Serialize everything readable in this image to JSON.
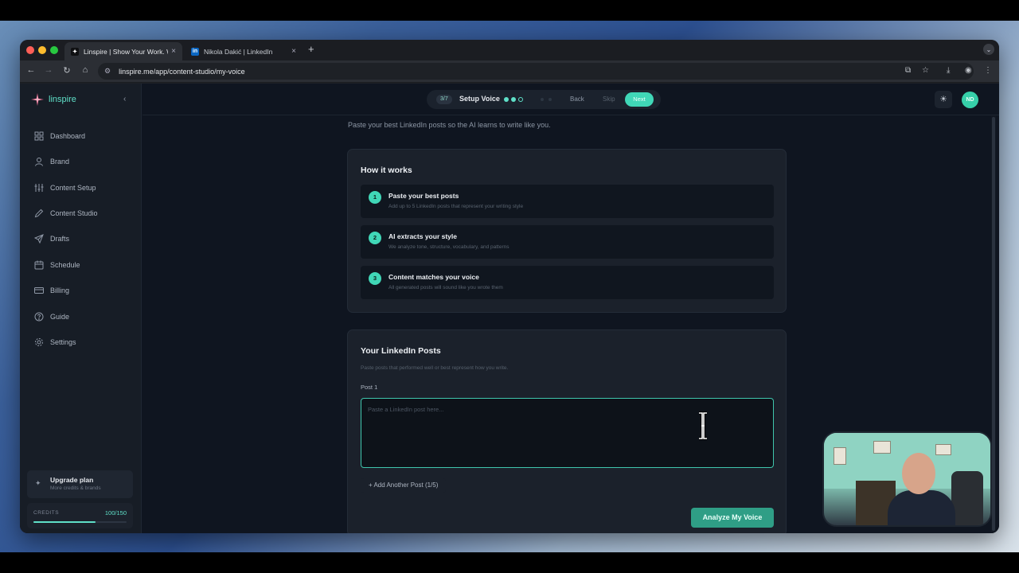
{
  "browser": {
    "tabs": [
      {
        "title": "Linspire | Show Your Work. W",
        "favicon": "linspire-icon",
        "active": true
      },
      {
        "title": "Nikola Dakić | LinkedIn",
        "favicon": "linkedin-icon",
        "active": false
      }
    ],
    "new_tab": "+",
    "url": "linspire.me/app/content-studio/my-voice"
  },
  "sidebar": {
    "brand": "linspire",
    "items": [
      {
        "label": "Dashboard",
        "icon": "grid-icon"
      },
      {
        "label": "Brand",
        "icon": "user-icon"
      },
      {
        "label": "Content Setup",
        "icon": "sliders-icon"
      },
      {
        "label": "Content Studio",
        "icon": "pencil-icon"
      },
      {
        "label": "Drafts",
        "icon": "send-icon"
      },
      {
        "label": "Schedule",
        "icon": "calendar-icon"
      },
      {
        "label": "Billing",
        "icon": "card-icon"
      },
      {
        "label": "Guide",
        "icon": "help-icon"
      },
      {
        "label": "Settings",
        "icon": "gear-icon"
      }
    ],
    "upgrade": {
      "title": "Upgrade plan",
      "subtitle": "More credits & brands"
    },
    "credits": {
      "label": "CREDITS",
      "value": "100/150",
      "fraction": 0.667
    }
  },
  "header": {
    "step_count": "3/7",
    "step_name": "Setup Voice",
    "back": "Back",
    "skip": "Skip",
    "next": "Next",
    "avatar_initials": "ND"
  },
  "main": {
    "subtitle": "Paste your best LinkedIn posts so the AI learns to write like you.",
    "how": {
      "title": "How it works",
      "steps": [
        {
          "num": "1",
          "title": "Paste your best posts",
          "desc": "Add up to 5 LinkedIn posts that represent your writing style"
        },
        {
          "num": "2",
          "title": "AI extracts your style",
          "desc": "We analyze tone, structure, vocabulary, and patterns"
        },
        {
          "num": "3",
          "title": "Content matches your voice",
          "desc": "All generated posts will sound like you wrote them"
        }
      ]
    },
    "posts": {
      "title": "Your LinkedIn Posts",
      "subtitle": "Paste posts that performed well or best represent how you write.",
      "post_label": "Post 1",
      "post_placeholder": "Paste a LinkedIn post here...",
      "post_value": "",
      "add_post": "+ Add Another Post (1/5)",
      "analyze": "Analyze My Voice"
    }
  },
  "colors": {
    "accent": "#40d7b7",
    "background": "#0f1520",
    "card": "#1b212b"
  }
}
